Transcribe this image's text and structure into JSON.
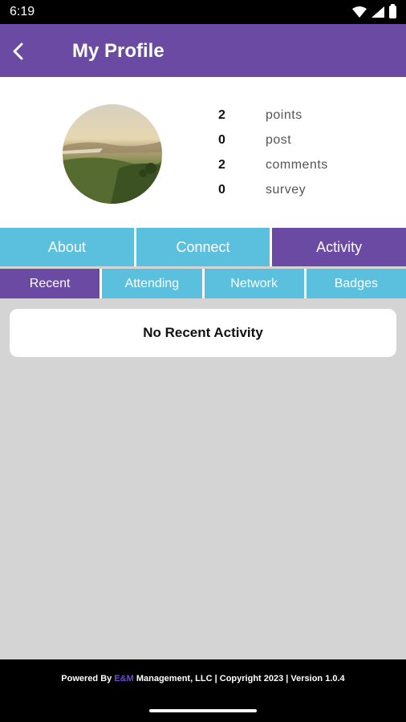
{
  "status_bar": {
    "time": "6:19"
  },
  "app_bar": {
    "title": "My Profile",
    "back_icon": "chevron-left-icon"
  },
  "stats": [
    {
      "value": "2",
      "label": "points"
    },
    {
      "value": "0",
      "label": "post"
    },
    {
      "value": "2",
      "label": "comments"
    },
    {
      "value": "0",
      "label": "survey"
    }
  ],
  "tabs": [
    {
      "label": "About"
    },
    {
      "label": "Connect"
    },
    {
      "label": "Activity"
    }
  ],
  "subtabs": [
    {
      "label": "Recent"
    },
    {
      "label": "Attending"
    },
    {
      "label": "Network"
    },
    {
      "label": "Badges"
    }
  ],
  "content": {
    "empty_message": "No Recent Activity"
  },
  "footer": {
    "prefix": "Powered By ",
    "brand": "E&M",
    "suffix": " Management, LLC | Copyright 2023 | Version 1.0.4"
  },
  "colors": {
    "primary": "#6a4aa2",
    "tab": "#5bc0de",
    "background": "#d4d4d4"
  }
}
